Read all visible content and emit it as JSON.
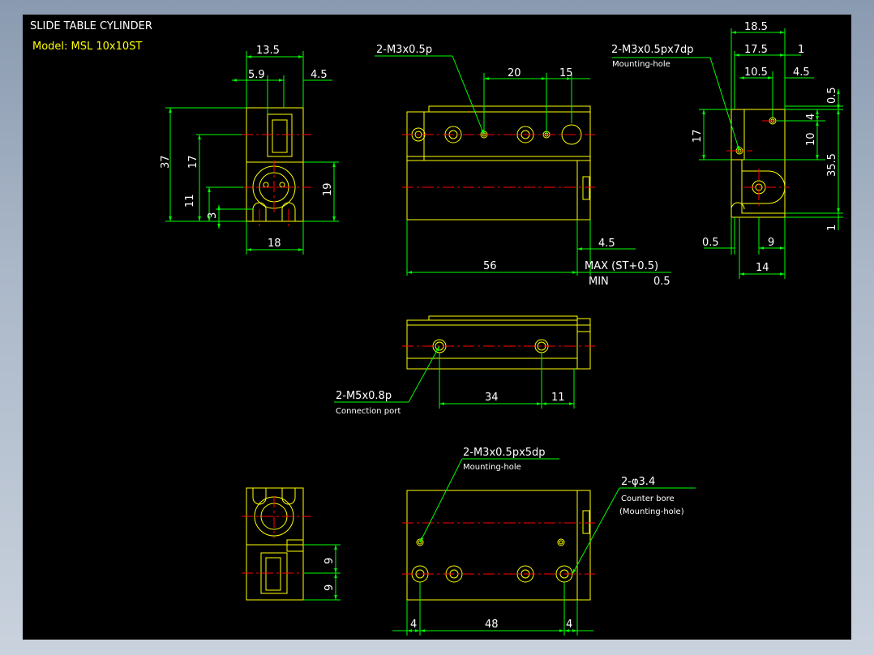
{
  "title": "SLIDE TABLE CYLINDER",
  "model": "Model: MSL 10x10ST",
  "colors": {
    "background": "#000000",
    "outline": "#ffff00",
    "dimension": "#00ff00",
    "center": "#ff0000",
    "text_white": "#ffffff"
  },
  "left_view": {
    "dims": {
      "w13_5": "13.5",
      "w5_9": "5.9",
      "w4_5": "4.5",
      "h37": "37",
      "h17": "17",
      "h11": "11",
      "h3": "3",
      "h19": "19",
      "w18": "18"
    }
  },
  "front_view": {
    "callout": "2-M3x0.5p",
    "dims": {
      "d20": "20",
      "d15": "15",
      "d4_5": "4.5",
      "d56": "56",
      "max": "MAX (ST+0.5)",
      "min": "MIN",
      "min_val": "0.5"
    }
  },
  "right_view": {
    "callout": "2-M3x0.5px7dp",
    "callout_note": "Mounting-hole",
    "dims": {
      "d18_5": "18.5",
      "d17_5": "17.5",
      "d1_top": "1",
      "d10_5": "10.5",
      "d4_5": "4.5",
      "d0_5_top": "0.5",
      "d4": "4",
      "d10": "10",
      "d17": "17",
      "d35_5": "35.5",
      "d1_bot": "1",
      "d0_5_bot": "0.5",
      "d9": "9",
      "d14": "14"
    }
  },
  "side_view": {
    "callout": "2-M5x0.8p",
    "callout_note": "Connection port",
    "dims": {
      "d34": "34",
      "d11": "11"
    }
  },
  "bottom_view": {
    "callout1": "2-M3x0.5px5dp",
    "callout1_note": "Mounting-hole",
    "callout2": "2-φ3.4",
    "callout2_note1": "Counter bore",
    "callout2_note2": "(Mounting-hole)",
    "dims": {
      "d4_left": "4",
      "d48": "48",
      "d4_right": "4"
    }
  },
  "bottom_left_view": {
    "dims": {
      "d9_top": "9",
      "d9_bot": "9"
    }
  }
}
